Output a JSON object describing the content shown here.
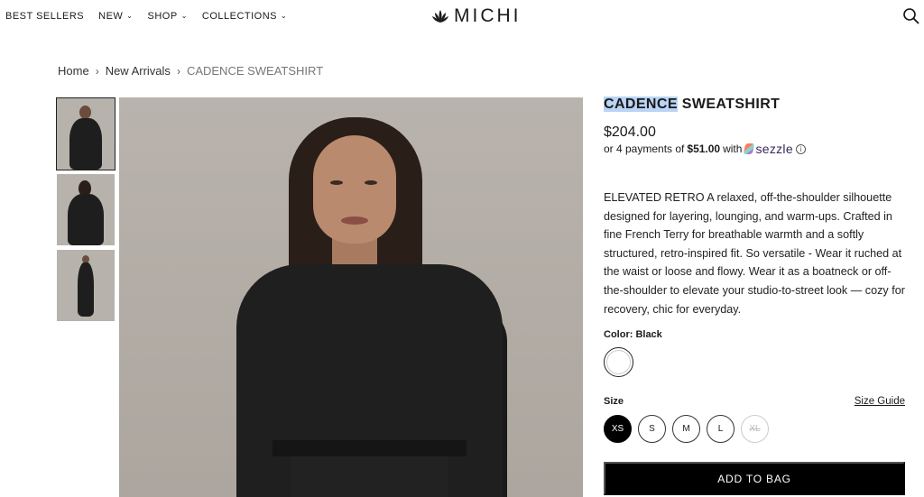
{
  "nav": {
    "items": [
      {
        "label": "BEST SELLERS",
        "has_chevron": false
      },
      {
        "label": "NEW",
        "has_chevron": true
      },
      {
        "label": "SHOP",
        "has_chevron": true
      },
      {
        "label": "COLLECTIONS",
        "has_chevron": true
      }
    ],
    "brand": "MICHI",
    "chevron_glyph": "⌄"
  },
  "breadcrumb": {
    "home": "Home",
    "sep": "›",
    "category": "New Arrivals",
    "current": "CADENCE SWEATSHIRT"
  },
  "product": {
    "title_highlight": "CADENCE",
    "title_rest": " SWEATSHIRT",
    "price": "$204.00",
    "installment_prefix": "or 4 payments of",
    "installment_amount": "$51.00",
    "installment_with": "with",
    "sezzle_brand": "sezzle",
    "info_glyph": "i",
    "description": "ELEVATED RETRO A relaxed, off-the-shoulder silhouette designed for layering, lounging, and warm-ups. Crafted in fine French Terry for breathable warmth and a softly structured, retro-inspired fit. So versatile - Wear it ruched at the waist or loose and flowy. Wear it as a boatneck or off-the-shoulder to elevate your studio-to-street look — cozy for recovery, chic for everyday.",
    "color_label": "Color: Black",
    "size_label": "Size",
    "size_guide": "Size Guide",
    "sizes": [
      {
        "label": "XS",
        "state": "selected"
      },
      {
        "label": "S",
        "state": "available"
      },
      {
        "label": "M",
        "state": "available"
      },
      {
        "label": "L",
        "state": "available"
      },
      {
        "label": "XL",
        "state": "unavailable"
      }
    ],
    "add_to_bag": "ADD TO BAG"
  },
  "colors": {
    "accent": "#000000",
    "highlight": "#b9d4f5",
    "text": "#1a1a1a"
  }
}
